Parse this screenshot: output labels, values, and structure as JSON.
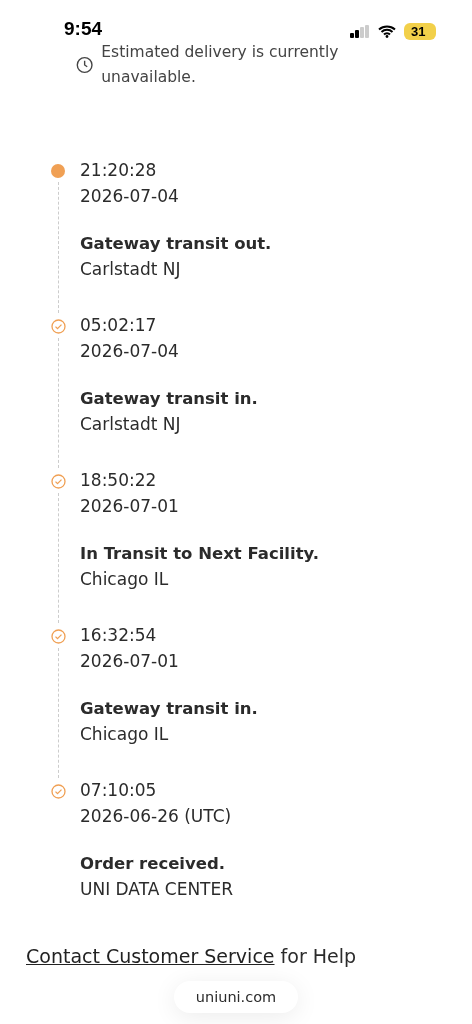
{
  "status_bar": {
    "time": "9:54",
    "battery": "31"
  },
  "estimate": {
    "text": "Estimated delivery is currently unavailable."
  },
  "events": [
    {
      "time": "21:20:28",
      "date": "2026-07-04",
      "title": "Gateway transit out.",
      "location": "Carlstadt NJ",
      "current": true
    },
    {
      "time": "05:02:17",
      "date": "2026-07-04",
      "title": "Gateway transit in.",
      "location": "Carlstadt NJ",
      "current": false
    },
    {
      "time": "18:50:22",
      "date": "2026-07-01",
      "title": "In Transit to Next Facility.",
      "location": "Chicago IL",
      "current": false
    },
    {
      "time": "16:32:54",
      "date": "2026-07-01",
      "title": "Gateway transit in.",
      "location": "Chicago IL",
      "current": false
    },
    {
      "time": "07:10:05",
      "date": "2026-06-26 (UTC)",
      "title": "Order received.",
      "location": "UNI DATA CENTER",
      "current": false
    }
  ],
  "help": {
    "link": "Contact Customer Service",
    "text": "for Help"
  },
  "url_bar": {
    "url": "uniuni.com"
  }
}
